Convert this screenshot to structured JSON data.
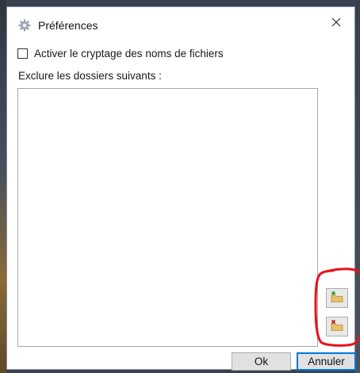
{
  "window": {
    "title": "Préférences",
    "close_icon": "close-icon",
    "app_icon": "gear-icon"
  },
  "options": {
    "encrypt_label": "Activer le cryptage des noms de fichiers",
    "encrypt_checked": false
  },
  "exclude": {
    "label": "Exclure les dossiers suivants :",
    "folders": []
  },
  "actions": {
    "add_icon": "folder-add-icon",
    "remove_icon": "folder-remove-icon",
    "ok_label": "Ok",
    "cancel_label": "Annuler"
  },
  "colors": {
    "annotation": "#e8121a",
    "focus_border": "#0078d7",
    "add_mark": "#2fa52a",
    "remove_mark": "#c0281e",
    "folder": "#e8c067"
  }
}
